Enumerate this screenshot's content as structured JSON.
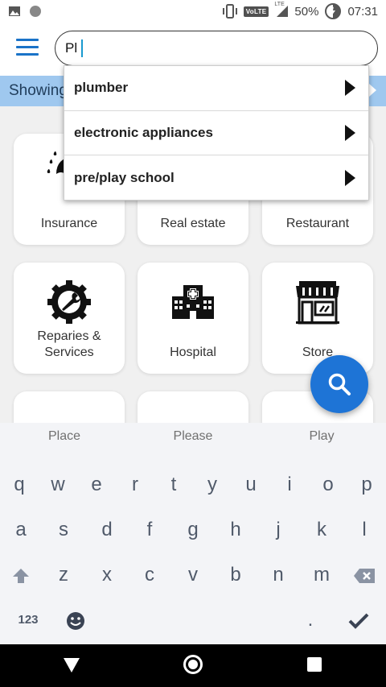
{
  "status_bar": {
    "volte": "VoLTE",
    "lte": "LTE",
    "battery": "50%",
    "time": "07:31",
    "icons": [
      "image-icon",
      "record-icon",
      "vibrate-icon",
      "signal-icon",
      "battery-charging-icon"
    ]
  },
  "search": {
    "value": "Pl"
  },
  "showing_bar": {
    "text": "Showing"
  },
  "suggestions": [
    {
      "label": "plumber"
    },
    {
      "label": "electronic appliances"
    },
    {
      "label": "pre/play school"
    }
  ],
  "categories": [
    {
      "label": "Insurance",
      "icon": "umbrella-icon"
    },
    {
      "label": "Real estate",
      "icon": "house-icon"
    },
    {
      "label": "Restaurant",
      "icon": "restaurant-icon"
    },
    {
      "label": "Reparies & Services",
      "icon": "tools-icon"
    },
    {
      "label": "Hospital",
      "icon": "hospital-icon"
    },
    {
      "label": "Store",
      "icon": "store-icon"
    },
    {
      "label": "",
      "icon": "electrician-icon"
    },
    {
      "label": "",
      "icon": "teacher-icon"
    },
    {
      "label": "",
      "icon": "sofa-icon"
    }
  ],
  "keyboard": {
    "suggestions": [
      "Place",
      "Please",
      "Play"
    ],
    "row1": [
      "q",
      "w",
      "e",
      "r",
      "t",
      "y",
      "u",
      "i",
      "o",
      "p"
    ],
    "row2": [
      "a",
      "s",
      "d",
      "f",
      "g",
      "h",
      "j",
      "k",
      "l"
    ],
    "row3": [
      "z",
      "x",
      "c",
      "v",
      "b",
      "n",
      "m"
    ],
    "numbers_key": "123",
    "period_key": "."
  },
  "colors": {
    "accent": "#1e74d6",
    "showing_bar": "#9fc8ef",
    "hamburger": "#1a73c8"
  }
}
